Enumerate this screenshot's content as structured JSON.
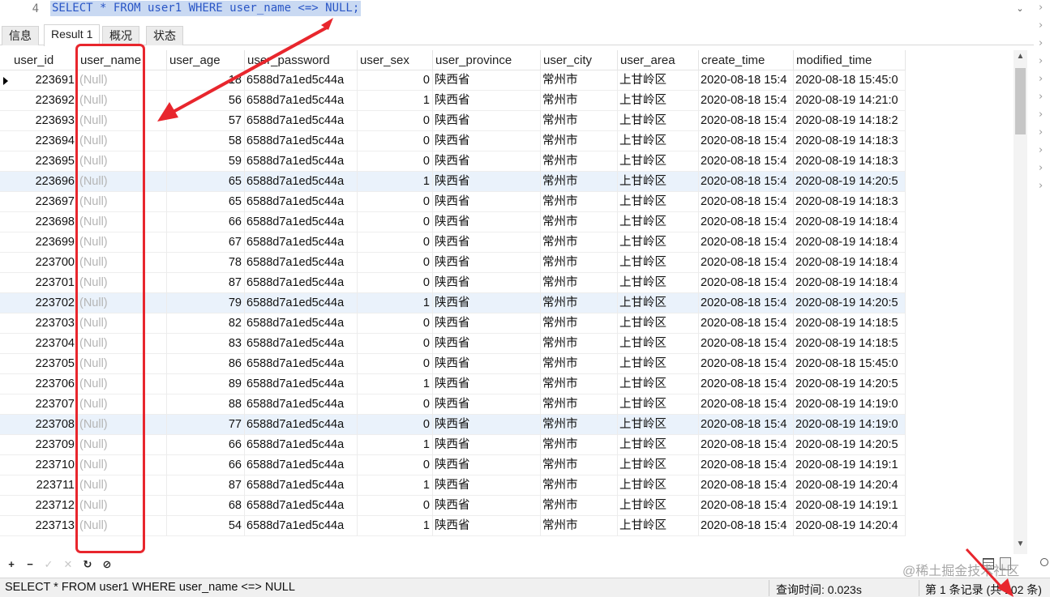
{
  "editor": {
    "line_number": "4",
    "sql": "SELECT * FROM user1 WHERE user_name <=> NULL;"
  },
  "tabs": [
    "信息",
    "Result 1",
    "概况",
    "状态"
  ],
  "grid": {
    "columns": [
      "user_id",
      "user_name",
      "user_age",
      "user_password",
      "user_sex",
      "user_province",
      "user_city",
      "user_area",
      "create_time",
      "modified_time"
    ],
    "rows": [
      [
        "223691",
        "(Null)",
        "18",
        "6588d7a1ed5c44a",
        "0",
        "陕西省",
        "常州市",
        "上甘岭区",
        "2020-08-18 15:4",
        "2020-08-18 15:45:0"
      ],
      [
        "223692",
        "(Null)",
        "56",
        "6588d7a1ed5c44a",
        "1",
        "陕西省",
        "常州市",
        "上甘岭区",
        "2020-08-18 15:4",
        "2020-08-19 14:21:0"
      ],
      [
        "223693",
        "(Null)",
        "57",
        "6588d7a1ed5c44a",
        "0",
        "陕西省",
        "常州市",
        "上甘岭区",
        "2020-08-18 15:4",
        "2020-08-19 14:18:2"
      ],
      [
        "223694",
        "(Null)",
        "58",
        "6588d7a1ed5c44a",
        "0",
        "陕西省",
        "常州市",
        "上甘岭区",
        "2020-08-18 15:4",
        "2020-08-19 14:18:3"
      ],
      [
        "223695",
        "(Null)",
        "59",
        "6588d7a1ed5c44a",
        "0",
        "陕西省",
        "常州市",
        "上甘岭区",
        "2020-08-18 15:4",
        "2020-08-19 14:18:3"
      ],
      [
        "223696",
        "(Null)",
        "65",
        "6588d7a1ed5c44a",
        "1",
        "陕西省",
        "常州市",
        "上甘岭区",
        "2020-08-18 15:4",
        "2020-08-19 14:20:5"
      ],
      [
        "223697",
        "(Null)",
        "65",
        "6588d7a1ed5c44a",
        "0",
        "陕西省",
        "常州市",
        "上甘岭区",
        "2020-08-18 15:4",
        "2020-08-19 14:18:3"
      ],
      [
        "223698",
        "(Null)",
        "66",
        "6588d7a1ed5c44a",
        "0",
        "陕西省",
        "常州市",
        "上甘岭区",
        "2020-08-18 15:4",
        "2020-08-19 14:18:4"
      ],
      [
        "223699",
        "(Null)",
        "67",
        "6588d7a1ed5c44a",
        "0",
        "陕西省",
        "常州市",
        "上甘岭区",
        "2020-08-18 15:4",
        "2020-08-19 14:18:4"
      ],
      [
        "223700",
        "(Null)",
        "78",
        "6588d7a1ed5c44a",
        "0",
        "陕西省",
        "常州市",
        "上甘岭区",
        "2020-08-18 15:4",
        "2020-08-19 14:18:4"
      ],
      [
        "223701",
        "(Null)",
        "87",
        "6588d7a1ed5c44a",
        "0",
        "陕西省",
        "常州市",
        "上甘岭区",
        "2020-08-18 15:4",
        "2020-08-19 14:18:4"
      ],
      [
        "223702",
        "(Null)",
        "79",
        "6588d7a1ed5c44a",
        "1",
        "陕西省",
        "常州市",
        "上甘岭区",
        "2020-08-18 15:4",
        "2020-08-19 14:20:5"
      ],
      [
        "223703",
        "(Null)",
        "82",
        "6588d7a1ed5c44a",
        "0",
        "陕西省",
        "常州市",
        "上甘岭区",
        "2020-08-18 15:4",
        "2020-08-19 14:18:5"
      ],
      [
        "223704",
        "(Null)",
        "83",
        "6588d7a1ed5c44a",
        "0",
        "陕西省",
        "常州市",
        "上甘岭区",
        "2020-08-18 15:4",
        "2020-08-19 14:18:5"
      ],
      [
        "223705",
        "(Null)",
        "86",
        "6588d7a1ed5c44a",
        "0",
        "陕西省",
        "常州市",
        "上甘岭区",
        "2020-08-18 15:4",
        "2020-08-18 15:45:0"
      ],
      [
        "223706",
        "(Null)",
        "89",
        "6588d7a1ed5c44a",
        "1",
        "陕西省",
        "常州市",
        "上甘岭区",
        "2020-08-18 15:4",
        "2020-08-19 14:20:5"
      ],
      [
        "223707",
        "(Null)",
        "88",
        "6588d7a1ed5c44a",
        "0",
        "陕西省",
        "常州市",
        "上甘岭区",
        "2020-08-18 15:4",
        "2020-08-19 14:19:0"
      ],
      [
        "223708",
        "(Null)",
        "77",
        "6588d7a1ed5c44a",
        "0",
        "陕西省",
        "常州市",
        "上甘岭区",
        "2020-08-18 15:4",
        "2020-08-19 14:19:0"
      ],
      [
        "223709",
        "(Null)",
        "66",
        "6588d7a1ed5c44a",
        "1",
        "陕西省",
        "常州市",
        "上甘岭区",
        "2020-08-18 15:4",
        "2020-08-19 14:20:5"
      ],
      [
        "223710",
        "(Null)",
        "66",
        "6588d7a1ed5c44a",
        "0",
        "陕西省",
        "常州市",
        "上甘岭区",
        "2020-08-18 15:4",
        "2020-08-19 14:19:1"
      ],
      [
        "223711",
        "(Null)",
        "87",
        "6588d7a1ed5c44a",
        "1",
        "陕西省",
        "常州市",
        "上甘岭区",
        "2020-08-18 15:4",
        "2020-08-19 14:20:4"
      ],
      [
        "223712",
        "(Null)",
        "68",
        "6588d7a1ed5c44a",
        "0",
        "陕西省",
        "常州市",
        "上甘岭区",
        "2020-08-18 15:4",
        "2020-08-19 14:19:1"
      ],
      [
        "223713",
        "(Null)",
        "54",
        "6588d7a1ed5c44a",
        "1",
        "陕西省",
        "常州市",
        "上甘岭区",
        "2020-08-18 15:4",
        "2020-08-19 14:20:4"
      ]
    ]
  },
  "toolbar": {
    "buttons": [
      {
        "glyph": "+",
        "icon": "add-record-icon",
        "enabled": true
      },
      {
        "glyph": "−",
        "icon": "delete-record-icon",
        "enabled": true
      },
      {
        "glyph": "✓",
        "icon": "apply-icon",
        "enabled": false
      },
      {
        "glyph": "✕",
        "icon": "discard-icon",
        "enabled": false
      },
      {
        "glyph": "↻",
        "icon": "refresh-icon",
        "enabled": true
      },
      {
        "glyph": "⊘",
        "icon": "stop-icon",
        "enabled": true
      }
    ]
  },
  "watermark": "@稀土掘金技术社区",
  "status": {
    "sql": "SELECT * FROM user1 WHERE user_name <=> NULL",
    "query_time": "查询时间: 0.023s",
    "records": "第 1 条记录 (共 102 条)"
  },
  "colors": {
    "annotation": "#e8262d",
    "sql_keyword": "#2a56c6",
    "selection": "#c9d9f2",
    "null_text": "#b5b5b5"
  }
}
